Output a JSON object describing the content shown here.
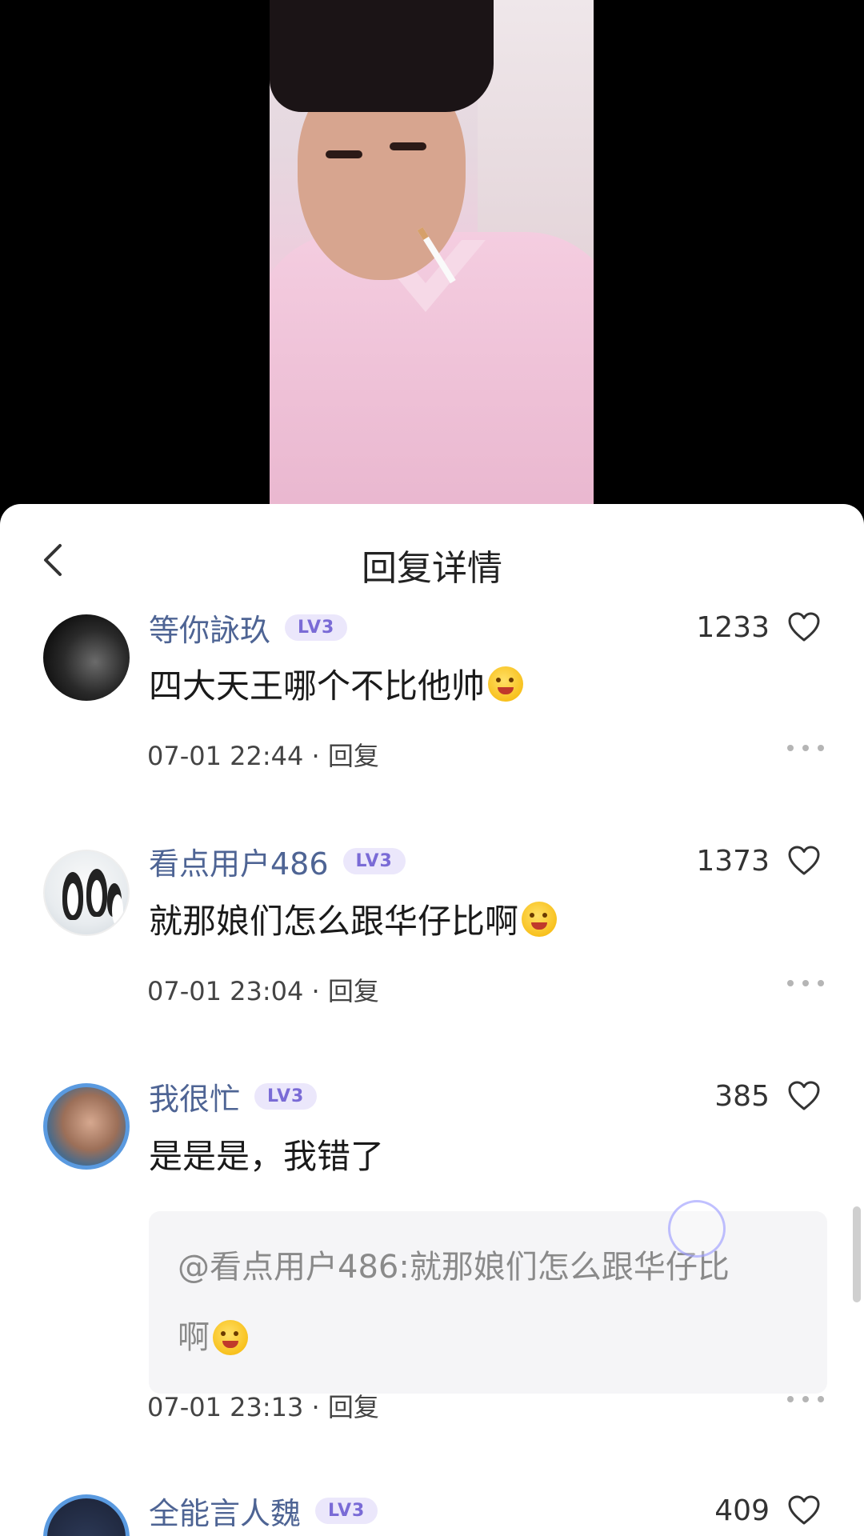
{
  "sheet": {
    "title": "回复详情",
    "back_icon": "chevron-left-icon"
  },
  "comments": [
    {
      "username": "等你詠玖",
      "level": "LV3",
      "likes": "1233",
      "text": "四大天王哪个不比他帅",
      "emoji": "drooling-face",
      "time": "07-01 22:44",
      "reply_label": "回复"
    },
    {
      "username": "看点用户486",
      "level": "LV3",
      "likes": "1373",
      "text": "就那娘们怎么跟华仔比啊",
      "emoji": "laughing-tears-face",
      "time": "07-01 23:04",
      "reply_label": "回复"
    },
    {
      "username": "我很忙",
      "level": "LV3",
      "likes": "385",
      "text": "是是是，我错了",
      "quote_line1": "@看点用户486:就那娘们怎么跟华仔比",
      "quote_line2": "啊",
      "quote_emoji": "laughing-tears-face",
      "time": "07-01 23:13",
      "reply_label": "回复"
    },
    {
      "username": "全能言人魏",
      "level": "LV3",
      "likes": "409"
    }
  ],
  "colors": {
    "username": "#4e6494",
    "badge_text": "#7a6bd6",
    "badge_bg": "#ebe7fb",
    "avatar_frame": "#5a9ae0"
  }
}
